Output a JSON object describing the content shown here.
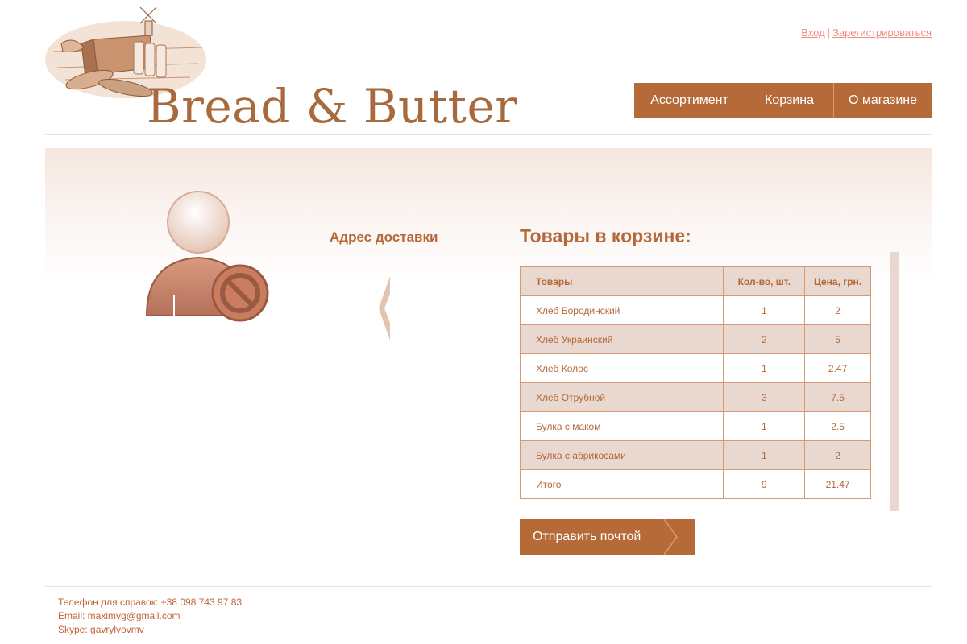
{
  "header": {
    "brand": "Bread & Butter",
    "auth": {
      "login": "Вход",
      "separator": "|",
      "register": "Зарегистрироваться"
    },
    "nav": [
      {
        "label": "Ассортимент"
      },
      {
        "label": "Корзина"
      },
      {
        "label": "О магазине"
      }
    ]
  },
  "address": {
    "title": "Адрес доставки"
  },
  "cart": {
    "title": "Товары в корзине:",
    "columns": [
      "Товары",
      "Кол-во, шт.",
      "Цена, грн."
    ],
    "rows": [
      {
        "name": "Хлеб Бородинский",
        "qty": "1",
        "price": "2"
      },
      {
        "name": "Хлеб Украинский",
        "qty": "2",
        "price": "5"
      },
      {
        "name": "Хлеб Колос",
        "qty": "1",
        "price": "2.47"
      },
      {
        "name": "Хлеб Отрубной",
        "qty": "3",
        "price": "7.5"
      },
      {
        "name": "Булка с маком",
        "qty": "1",
        "price": "2.5"
      },
      {
        "name": "Булка с абрикосами",
        "qty": "1",
        "price": "2"
      },
      {
        "name": "Итого",
        "qty": "9",
        "price": "21.47"
      }
    ],
    "send_label": "Отправить почтой"
  },
  "footer": {
    "phone": "Телефон для справок: +38 098 743 97 83",
    "email": "Email: maximvg@gmail.com",
    "skype": "Skype: gavrylvovmv"
  },
  "colors": {
    "accent": "#b56a38",
    "text": "#b5683a",
    "row_alt": "#e8d8cf",
    "auth_link": "#f08c82"
  },
  "icons": [
    "bread-logo-icon",
    "user-blocked-icon",
    "chevron-left-icon",
    "chevron-right-icon"
  ]
}
